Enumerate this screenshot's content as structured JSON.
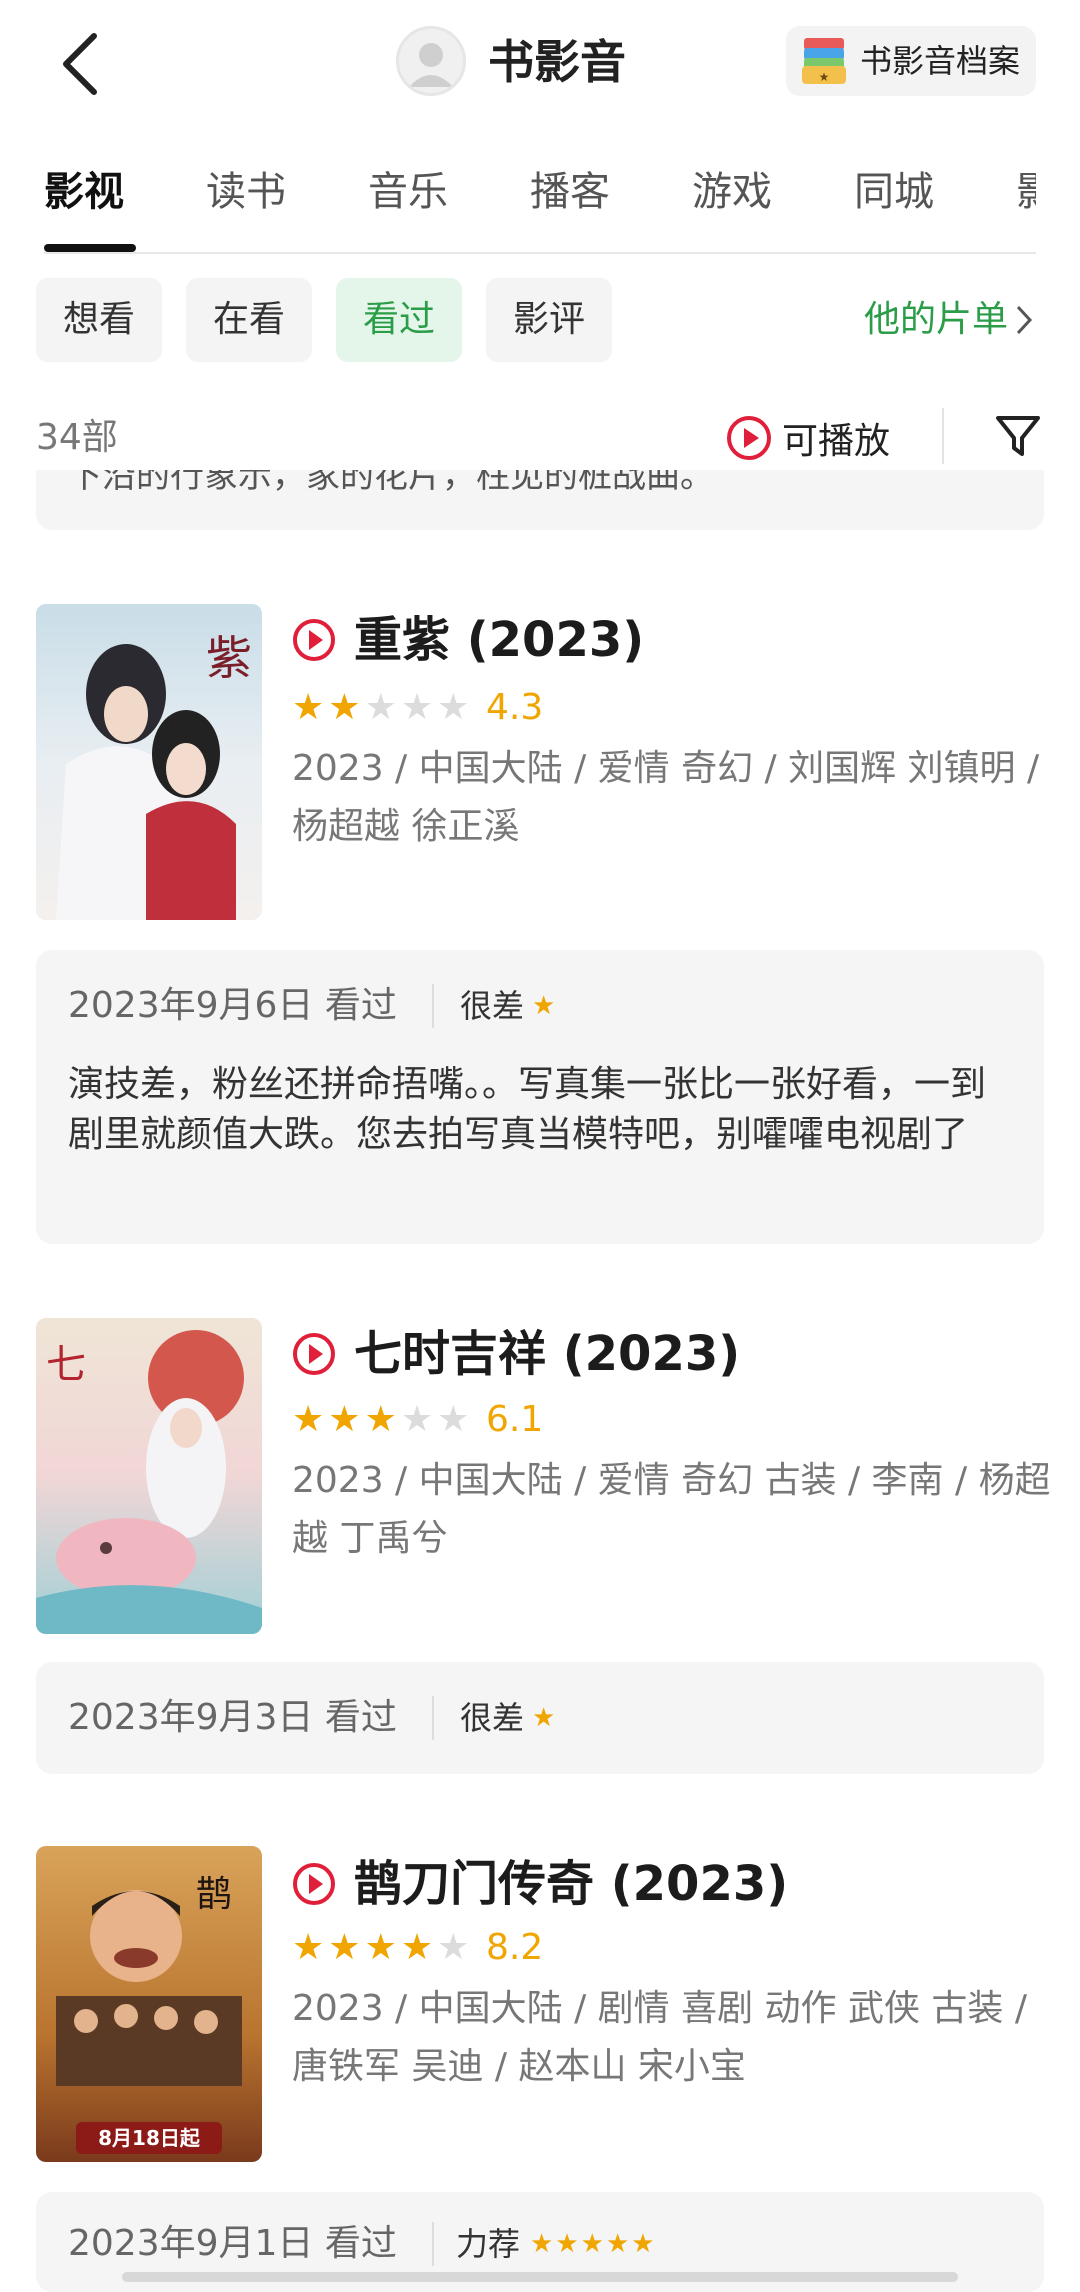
{
  "header": {
    "title": "书影音",
    "archive_label": "书影音档案"
  },
  "tabs": [
    {
      "label": "影视",
      "active": true
    },
    {
      "label": "读书"
    },
    {
      "label": "音乐"
    },
    {
      "label": "播客"
    },
    {
      "label": "游戏"
    },
    {
      "label": "同城"
    },
    {
      "label": "影"
    }
  ],
  "filters": [
    {
      "label": "想看"
    },
    {
      "label": "在看"
    },
    {
      "label": "看过",
      "active": true
    },
    {
      "label": "影评"
    }
  ],
  "list_link": "他的片单",
  "count": "34部",
  "playable": "可播放",
  "remnant_text": "下沿的行象示，家的花片，柱见的桩战曲。",
  "colors": {
    "accent_green": "#2b9d48",
    "star": "#f0a500",
    "play_red": "#e0203a"
  },
  "movies": [
    {
      "title": "重紫 (2023)",
      "stars_filled": 2,
      "rating": "4.3",
      "meta": "2023 / 中国大陆 / 爱情 奇幻 / 刘国辉 刘镇明 / 杨超越 徐正溪",
      "review": {
        "date": "2023年9月6日 看过",
        "grade": "很差",
        "grade_stars": 1,
        "text": "演技差，粉丝还拼命捂嘴。。写真集一张比一张好看，一到剧里就颜值大跌。您去拍写真当模特吧，别嚯嚯电视剧了"
      }
    },
    {
      "title": "七时吉祥 (2023)",
      "stars_filled": 3,
      "rating": "6.1",
      "meta": "2023 / 中国大陆 / 爱情 奇幻 古装 / 李南 / 杨超越 丁禹兮",
      "review": {
        "date": "2023年9月3日 看过",
        "grade": "很差",
        "grade_stars": 1
      }
    },
    {
      "title": "鹊刀门传奇 (2023)",
      "stars_filled": 4,
      "rating": "8.2",
      "meta": "2023 / 中国大陆 / 剧情 喜剧 动作 武侠 古装 / 唐铁军 吴迪 / 赵本山 宋小宝",
      "poster_text": "8月18日起",
      "review": {
        "date": "2023年9月1日 看过",
        "grade": "力荐",
        "grade_stars": 5
      }
    }
  ]
}
